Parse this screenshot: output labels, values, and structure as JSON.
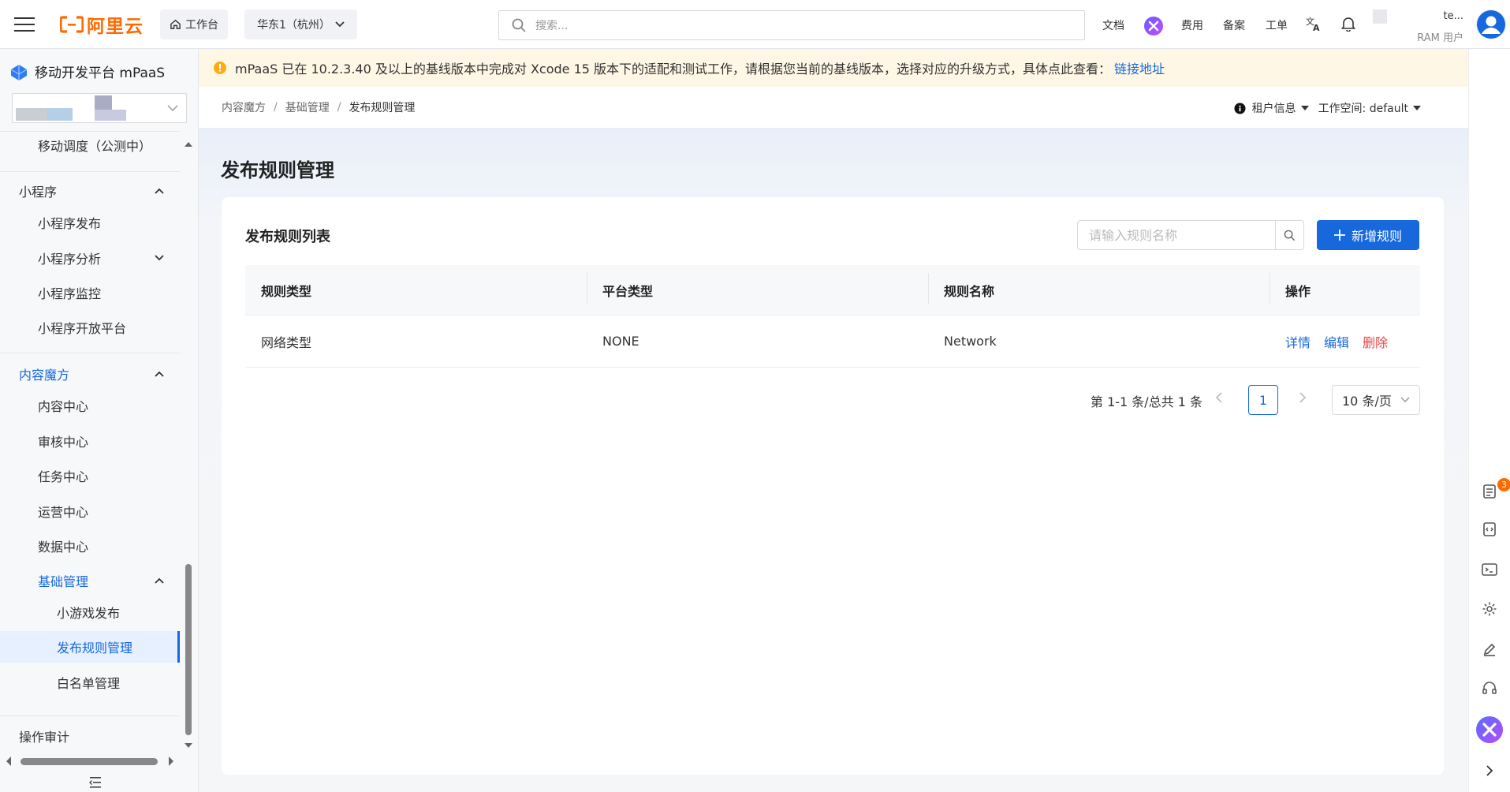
{
  "topbar": {
    "logo_text": "阿里云",
    "workbench_label": "工作台",
    "region_label": "华东1（杭州）",
    "search_placeholder": "搜索...",
    "links": [
      "文档",
      "费用",
      "备案",
      "工单"
    ],
    "user_name": "te...",
    "user_role": "RAM 用户"
  },
  "sidebar": {
    "product_title": "移动开发平台 mPaaS",
    "items": [
      {
        "label": "移动调度（公测中）"
      },
      {
        "label": "小程序"
      },
      {
        "label": "小程序发布"
      },
      {
        "label": "小程序分析"
      },
      {
        "label": "小程序监控"
      },
      {
        "label": "小程序开放平台"
      },
      {
        "label": "内容魔方"
      },
      {
        "label": "内容中心"
      },
      {
        "label": "审核中心"
      },
      {
        "label": "任务中心"
      },
      {
        "label": "运营中心"
      },
      {
        "label": "数据中心"
      },
      {
        "label": "基础管理"
      },
      {
        "label": "小游戏发布"
      },
      {
        "label": "发布规则管理"
      },
      {
        "label": "白名单管理"
      },
      {
        "label": "操作审计"
      }
    ]
  },
  "notice": {
    "message": "mPaaS 已在 10.2.3.40 及以上的基线版本中完成对 Xcode 15 版本下的适配和测试工作，请根据您当前的基线版本，选择对应的升级方式，具体点此查看：",
    "link": "链接地址"
  },
  "breadcrumb": [
    "内容魔方",
    "基础管理",
    "发布规则管理"
  ],
  "tenant": {
    "tenant_label": "租户信息",
    "workspace_label": "工作空间: default"
  },
  "page": {
    "title": "发布规则管理",
    "card_title": "发布规则列表",
    "search_placeholder": "请输入规则名称",
    "add_button": "新增规则"
  },
  "table": {
    "columns": [
      "规则类型",
      "平台类型",
      "规则名称",
      "操作"
    ],
    "rows": [
      {
        "type": "网络类型",
        "platform": "NONE",
        "name": "Network",
        "actions": [
          "详情",
          "编辑",
          "删除"
        ]
      }
    ]
  },
  "pagination": {
    "total_text": "第 1-1 条/总共 1 条",
    "current_page": "1",
    "page_size": "10 条/页"
  },
  "rail": {
    "badge_count": "3"
  },
  "colors": {
    "brand": "#ff6a00",
    "primary": "#1668dc",
    "danger": "#e84749",
    "notice_bg": "#fff7e6"
  }
}
